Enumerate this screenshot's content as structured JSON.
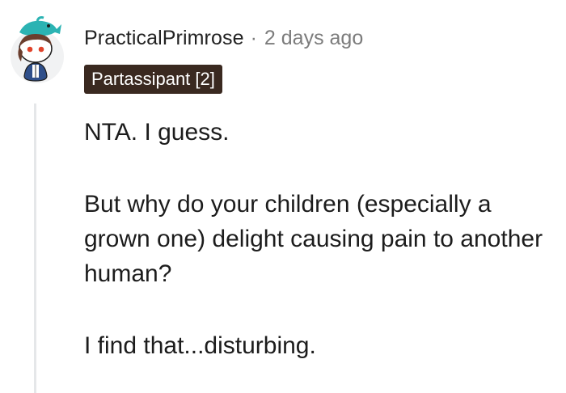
{
  "comment": {
    "author": "PracticalPrimrose",
    "separator": "·",
    "timestamp": "2 days ago",
    "flair": "Partassipant [2]",
    "paragraphs": [
      "NTA. I guess.",
      "But why do your children (especially a grown one) delight causing pain to another human?",
      "I find that...disturbing."
    ]
  },
  "colors": {
    "flair_background": "#3a2920",
    "flair_text": "#ffffff",
    "muted_text": "#7c7c7c",
    "thread_line": "#e5e7e9",
    "avatar_accent": "#2bb3b3"
  },
  "icons": {
    "avatar": "snoo-avatar-icon"
  }
}
